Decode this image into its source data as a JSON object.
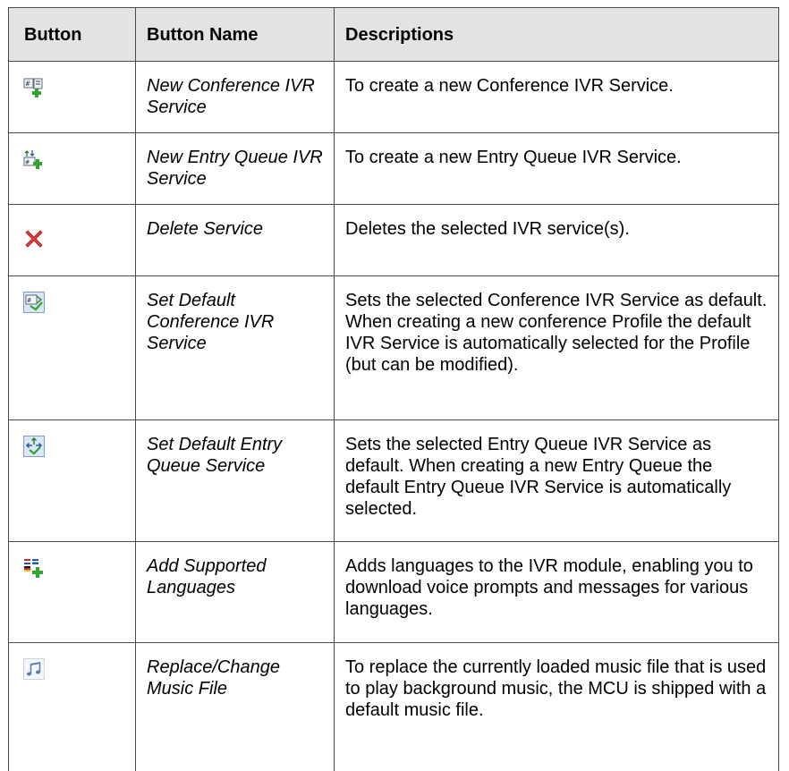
{
  "table": {
    "headers": {
      "button": "Button",
      "name": "Button Name",
      "description": "Descriptions"
    },
    "rows": [
      {
        "icon": "new-conference-ivr-icon",
        "name": "New Conference IVR Service",
        "description": "To create a new Conference IVR Service."
      },
      {
        "icon": "new-entry-queue-ivr-icon",
        "name": "New Entry Queue IVR Service",
        "description": "To create a new Entry Queue IVR Service."
      },
      {
        "icon": "delete-icon",
        "name": "Delete Service",
        "description": "Deletes the selected IVR service(s)."
      },
      {
        "icon": "set-default-conference-icon",
        "name": "Set Default Conference IVR Service",
        "description": "Sets the selected Conference IVR Service as default. When creating a new conference Profile the default IVR Service is automatically selected for the Profile (but can be modified)."
      },
      {
        "icon": "set-default-entry-queue-icon",
        "name": "Set Default Entry Queue Service",
        "description": "Sets the selected Entry Queue IVR Service as default. When creating a new Entry Queue the default Entry Queue IVR Service is automatically selected."
      },
      {
        "icon": "add-languages-icon",
        "name": "Add Supported Languages",
        "description": "Adds languages to the IVR module, enabling you to download voice prompts and messages for various languages."
      },
      {
        "icon": "music-file-icon",
        "name": "Replace/Change Music File",
        "description": "To replace the currently loaded music file that is used to play background music, the MCU is shipped with a default music file."
      }
    ]
  }
}
